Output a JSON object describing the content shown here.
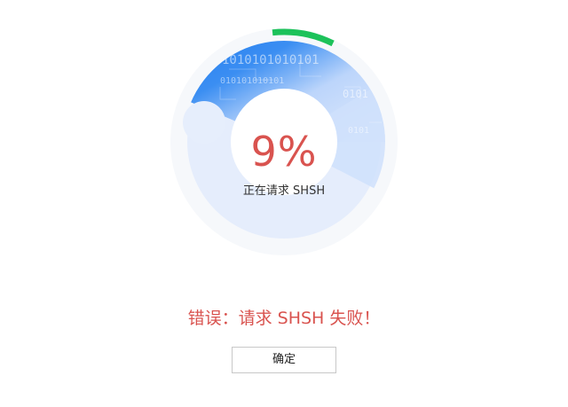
{
  "progress": {
    "percent_text": "9%",
    "value": 0.09,
    "status_label": "正在请求 SHSH",
    "binary_text_1": "1010101010101",
    "binary_text_2": "010101010101",
    "binary_text_3": "0101",
    "binary_text_4": "0101",
    "colors": {
      "track_light": "#e6eefc",
      "track_blue": "#2a84f0",
      "progress_arc": "#1cc25a",
      "outer_halo": "#f4f6f9"
    }
  },
  "error": {
    "message": "错误：请求 SHSH 失败！",
    "color": "#d9534f"
  },
  "dialog": {
    "confirm_label": "确定"
  }
}
